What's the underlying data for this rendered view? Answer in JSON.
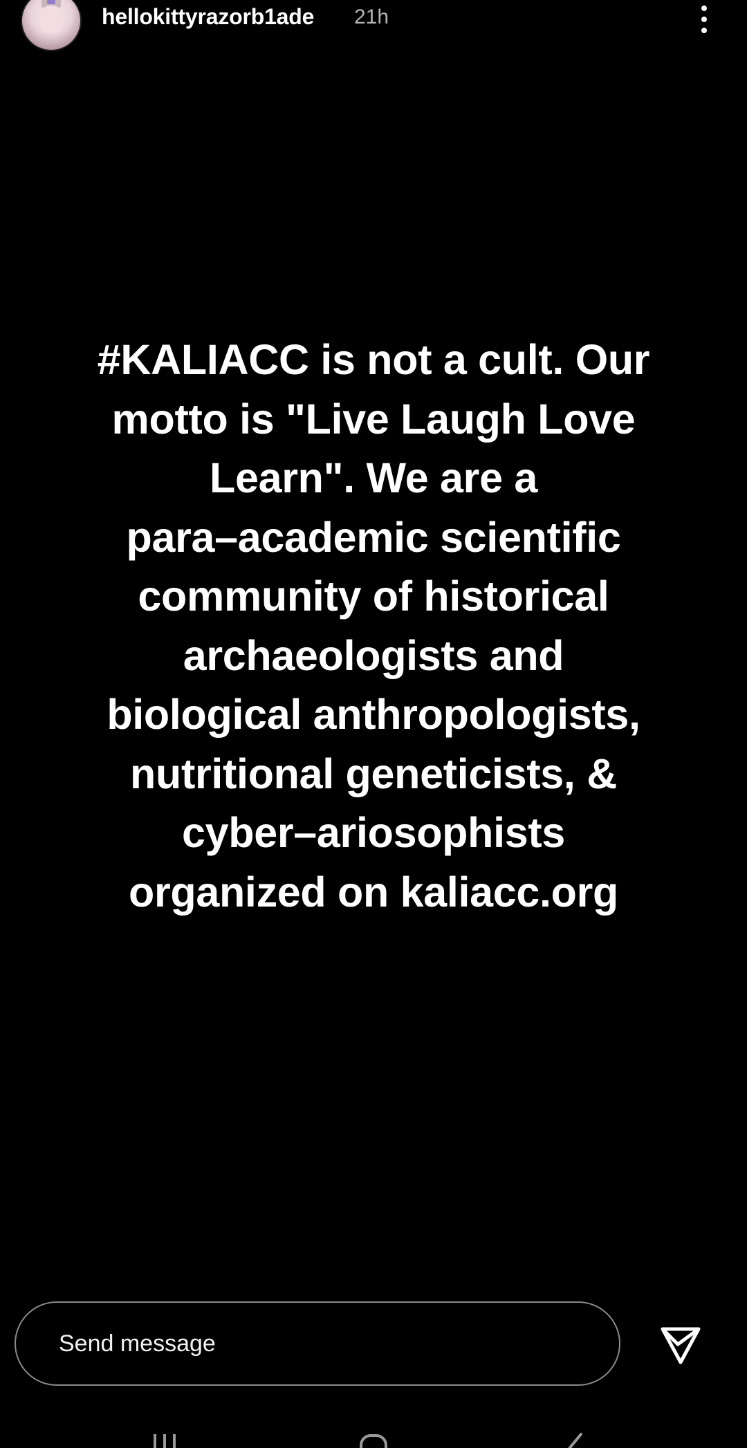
{
  "story_header": {
    "username": "hellokittyrazorb1ade",
    "timestamp": "21h",
    "menu_icon": "more-vertical-icon"
  },
  "story": {
    "lines": [
      "#KALIACC is not a cult. Our",
      "motto is \"Live Laugh Love",
      "Learn\". We are a",
      "para–academic scientific",
      "community of historical",
      "archaeologists and",
      "biological anthropologists,",
      "nutritional geneticists, &",
      "cyber–ariosophists",
      "organized on kaliacc.org"
    ],
    "background_color": "#000000",
    "text_color": "#ffffff"
  },
  "reply": {
    "placeholder": "Send message",
    "value": "",
    "send_icon": "send-icon"
  },
  "system_nav": {
    "recent_icon": "recent-apps-icon",
    "home_icon": "home-icon",
    "back_icon": "back-icon"
  }
}
